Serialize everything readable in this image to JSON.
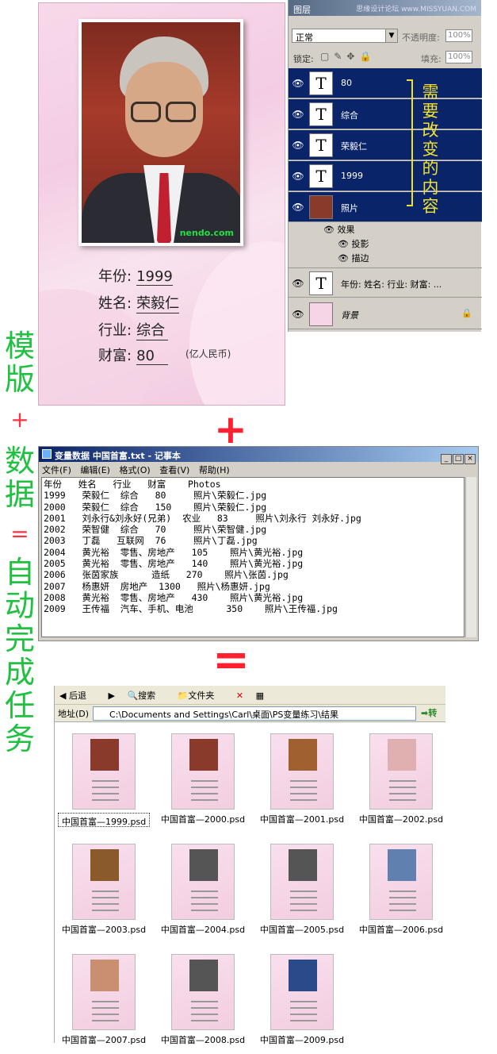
{
  "watermark": "思缘设计论坛  www.MISSYUAN.COM",
  "side_text": {
    "template": [
      "模",
      "版"
    ],
    "plus": "+",
    "data": [
      "数",
      "据"
    ],
    "equals": "=",
    "auto": [
      "自",
      "动",
      "完",
      "成",
      "任",
      "务"
    ]
  },
  "card": {
    "photo_watermark": "nendo.com",
    "fields": [
      {
        "label": "年份:",
        "value": "1999"
      },
      {
        "label": "姓名:",
        "value": "荣毅仁"
      },
      {
        "label": "行业:",
        "value": "综合"
      },
      {
        "label": "财富:",
        "value": "80"
      }
    ],
    "unit": "(亿人民币)"
  },
  "layers_panel": {
    "tab": "图层",
    "blend_mode": "正常",
    "opacity_label": "不透明度:",
    "opacity_value": "100%",
    "lock_label": "锁定:",
    "fill_label": "填充:",
    "fill_value": "100%",
    "layers": [
      {
        "name": "80",
        "type": "text",
        "selected": true
      },
      {
        "name": "综合",
        "type": "text",
        "selected": true
      },
      {
        "name": "荣毅仁",
        "type": "text",
        "selected": true
      },
      {
        "name": "1999",
        "type": "text",
        "selected": true
      },
      {
        "name": "照片",
        "type": "image",
        "selected": true
      },
      {
        "name": "年份: 姓名: 行业: 财富: ...",
        "type": "text",
        "selected": false
      },
      {
        "name": "背景",
        "type": "background",
        "selected": false
      }
    ],
    "effects_label": "效果",
    "effect_items": [
      "投影",
      "描边"
    ],
    "annotation": [
      "需",
      "要",
      "改",
      "变",
      "的",
      "内",
      "容"
    ],
    "annotation_color": "#f0e030"
  },
  "plus_sign": "+",
  "equals_sign": "=",
  "notepad": {
    "title": "变量数据 中国首富.txt - 记事本",
    "menu": [
      "文件(F)",
      "编辑(E)",
      "格式(O)",
      "查看(V)",
      "帮助(H)"
    ],
    "lines": [
      "年份   姓名   行业   财富    Photos",
      "1999   荣毅仁  综合   80     照片\\荣毅仁.jpg",
      "2000   荣毅仁  综合   150    照片\\荣毅仁.jpg",
      "2001   刘永行&刘永好(兄弟)  农业   83     照片\\刘永行 刘永好.jpg",
      "2002   荣智健  综合   70     照片\\荣智健.jpg",
      "2003   丁磊   互联网  76     照片\\丁磊.jpg",
      "2004   黄光裕  零售、房地产   105    照片\\黄光裕.jpg",
      "2005   黄光裕  零售、房地产   140    照片\\黄光裕.jpg",
      "2006   张茵家族      造纸   270    照片\\张茵.jpg",
      "2007   杨惠妍  房地产  1300   照片\\杨惠妍.jpg",
      "2008   黄光裕  零售、房地产   430    照片\\黄光裕.jpg",
      "2009   王传福  汽车、手机、电池      350    照片\\王传福.jpg"
    ]
  },
  "explorer": {
    "toolbar": [
      "后退",
      "搜索",
      "文件夹"
    ],
    "address_label": "地址(D)",
    "address": "C:\\Documents and Settings\\Carl\\桌面\\PS变量练习\\结果",
    "go": "转",
    "files": [
      "中国首富—1999.psd",
      "中国首富—2000.psd",
      "中国首富—2001.psd",
      "中国首富—2002.psd",
      "中国首富—2003.psd",
      "中国首富—2004.psd",
      "中国首富—2005.psd",
      "中国首富—2006.psd",
      "中国首富—2007.psd",
      "中国首富—2008.psd",
      "中国首富—2009.psd"
    ]
  }
}
